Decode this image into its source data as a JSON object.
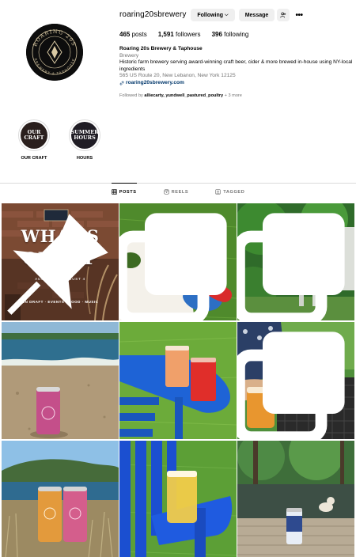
{
  "profile": {
    "username": "roaring20sbrewery",
    "avatar_ring_text_top": "ROARING 20S",
    "avatar_ring_text_bottom": "BREWERY & TAPHOUSE",
    "following_button": "Following",
    "message_button": "Message",
    "stats": {
      "posts_count": "465",
      "posts_label": "posts",
      "followers_count": "1,591",
      "followers_label": "followers",
      "following_count": "396",
      "following_label": "following"
    },
    "bio": {
      "name": "Roaring 20s Brewery & Taphouse",
      "category": "Brewery",
      "description": "Historic farm brewery serving award-winning craft beer, cider & more brewed in-house using NY-local ingredients",
      "address": "565 US Route 20, New Lebanon, New York 12125",
      "link": "roaring20sbrewery.com"
    },
    "followed_by_prefix": "Followed by",
    "followed_by_names": "alliecarty, yundwell_pastured_poultry",
    "followed_by_suffix": "+ 3 more"
  },
  "highlights": [
    {
      "cover_line1": "OUR",
      "cover_line2": "CRAFT",
      "label": "OUR CRAFT"
    },
    {
      "cover_line1": "SUMMER",
      "cover_line2": "HOURS",
      "label": "HOURS"
    }
  ],
  "tabs": [
    {
      "label": "POSTS",
      "icon": "grid-icon",
      "active": true
    },
    {
      "label": "REELS",
      "icon": "reels-icon",
      "active": false
    },
    {
      "label": "TAGGED",
      "icon": "tagged-icon",
      "active": false
    }
  ],
  "posts": {
    "pinned_post": {
      "line1": "WHAT'S",
      "line2": "ON TAP",
      "dates": "AUGUST 1 · AUGUST 4",
      "subline": "ON DRAFT · EVENTS · FOOD · MUSIC"
    }
  },
  "colors": {
    "link_blue": "#00376b",
    "secondary_text": "#737373",
    "button_bg": "#efefef",
    "divider": "#dbdbdb"
  }
}
